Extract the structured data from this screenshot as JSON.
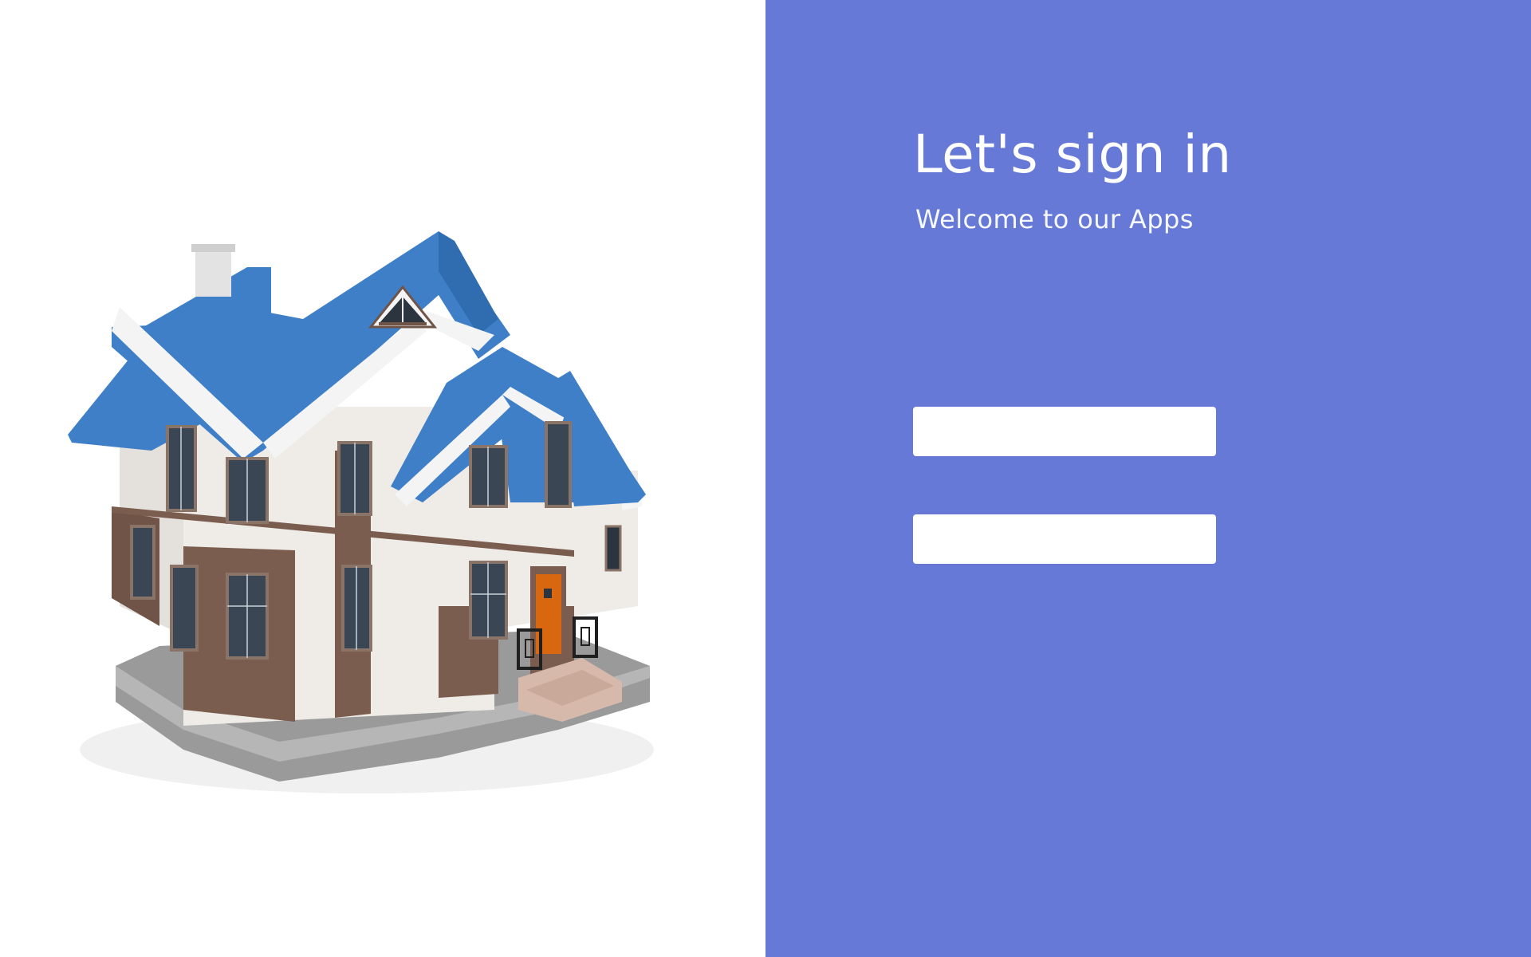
{
  "theme": {
    "right_panel_background": "#6679d7",
    "left_panel_background": "#ffffff",
    "text_color": "#ffffff",
    "field_background": "#ffffff",
    "roof_color": "#3f7fc8",
    "wall_color": "#eeeae6",
    "brick_color": "#7b5d4f",
    "door_color": "#d8670f"
  },
  "hero": {
    "image_name": "house-illustration"
  },
  "login": {
    "title": "Let's sign in",
    "subtitle": "Welcome to our Apps",
    "username": {
      "value": "",
      "placeholder": ""
    },
    "password": {
      "value": "",
      "placeholder": ""
    }
  }
}
